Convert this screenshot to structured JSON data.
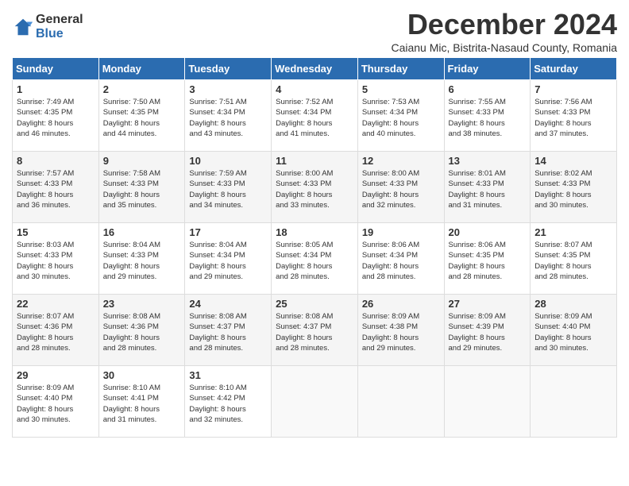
{
  "logo": {
    "general": "General",
    "blue": "Blue"
  },
  "title": "December 2024",
  "location": "Caianu Mic, Bistrita-Nasaud County, Romania",
  "days_of_week": [
    "Sunday",
    "Monday",
    "Tuesday",
    "Wednesday",
    "Thursday",
    "Friday",
    "Saturday"
  ],
  "weeks": [
    [
      {
        "day": "1",
        "sunrise": "7:49 AM",
        "sunset": "4:35 PM",
        "daylight": "8 hours and 46 minutes."
      },
      {
        "day": "2",
        "sunrise": "7:50 AM",
        "sunset": "4:35 PM",
        "daylight": "8 hours and 44 minutes."
      },
      {
        "day": "3",
        "sunrise": "7:51 AM",
        "sunset": "4:34 PM",
        "daylight": "8 hours and 43 minutes."
      },
      {
        "day": "4",
        "sunrise": "7:52 AM",
        "sunset": "4:34 PM",
        "daylight": "8 hours and 41 minutes."
      },
      {
        "day": "5",
        "sunrise": "7:53 AM",
        "sunset": "4:34 PM",
        "daylight": "8 hours and 40 minutes."
      },
      {
        "day": "6",
        "sunrise": "7:55 AM",
        "sunset": "4:33 PM",
        "daylight": "8 hours and 38 minutes."
      },
      {
        "day": "7",
        "sunrise": "7:56 AM",
        "sunset": "4:33 PM",
        "daylight": "8 hours and 37 minutes."
      }
    ],
    [
      {
        "day": "8",
        "sunrise": "7:57 AM",
        "sunset": "4:33 PM",
        "daylight": "8 hours and 36 minutes."
      },
      {
        "day": "9",
        "sunrise": "7:58 AM",
        "sunset": "4:33 PM",
        "daylight": "8 hours and 35 minutes."
      },
      {
        "day": "10",
        "sunrise": "7:59 AM",
        "sunset": "4:33 PM",
        "daylight": "8 hours and 34 minutes."
      },
      {
        "day": "11",
        "sunrise": "8:00 AM",
        "sunset": "4:33 PM",
        "daylight": "8 hours and 33 minutes."
      },
      {
        "day": "12",
        "sunrise": "8:00 AM",
        "sunset": "4:33 PM",
        "daylight": "8 hours and 32 minutes."
      },
      {
        "day": "13",
        "sunrise": "8:01 AM",
        "sunset": "4:33 PM",
        "daylight": "8 hours and 31 minutes."
      },
      {
        "day": "14",
        "sunrise": "8:02 AM",
        "sunset": "4:33 PM",
        "daylight": "8 hours and 30 minutes."
      }
    ],
    [
      {
        "day": "15",
        "sunrise": "8:03 AM",
        "sunset": "4:33 PM",
        "daylight": "8 hours and 30 minutes."
      },
      {
        "day": "16",
        "sunrise": "8:04 AM",
        "sunset": "4:33 PM",
        "daylight": "8 hours and 29 minutes."
      },
      {
        "day": "17",
        "sunrise": "8:04 AM",
        "sunset": "4:34 PM",
        "daylight": "8 hours and 29 minutes."
      },
      {
        "day": "18",
        "sunrise": "8:05 AM",
        "sunset": "4:34 PM",
        "daylight": "8 hours and 28 minutes."
      },
      {
        "day": "19",
        "sunrise": "8:06 AM",
        "sunset": "4:34 PM",
        "daylight": "8 hours and 28 minutes."
      },
      {
        "day": "20",
        "sunrise": "8:06 AM",
        "sunset": "4:35 PM",
        "daylight": "8 hours and 28 minutes."
      },
      {
        "day": "21",
        "sunrise": "8:07 AM",
        "sunset": "4:35 PM",
        "daylight": "8 hours and 28 minutes."
      }
    ],
    [
      {
        "day": "22",
        "sunrise": "8:07 AM",
        "sunset": "4:36 PM",
        "daylight": "8 hours and 28 minutes."
      },
      {
        "day": "23",
        "sunrise": "8:08 AM",
        "sunset": "4:36 PM",
        "daylight": "8 hours and 28 minutes."
      },
      {
        "day": "24",
        "sunrise": "8:08 AM",
        "sunset": "4:37 PM",
        "daylight": "8 hours and 28 minutes."
      },
      {
        "day": "25",
        "sunrise": "8:08 AM",
        "sunset": "4:37 PM",
        "daylight": "8 hours and 28 minutes."
      },
      {
        "day": "26",
        "sunrise": "8:09 AM",
        "sunset": "4:38 PM",
        "daylight": "8 hours and 29 minutes."
      },
      {
        "day": "27",
        "sunrise": "8:09 AM",
        "sunset": "4:39 PM",
        "daylight": "8 hours and 29 minutes."
      },
      {
        "day": "28",
        "sunrise": "8:09 AM",
        "sunset": "4:40 PM",
        "daylight": "8 hours and 30 minutes."
      }
    ],
    [
      {
        "day": "29",
        "sunrise": "8:09 AM",
        "sunset": "4:40 PM",
        "daylight": "8 hours and 30 minutes."
      },
      {
        "day": "30",
        "sunrise": "8:10 AM",
        "sunset": "4:41 PM",
        "daylight": "8 hours and 31 minutes."
      },
      {
        "day": "31",
        "sunrise": "8:10 AM",
        "sunset": "4:42 PM",
        "daylight": "8 hours and 32 minutes."
      },
      null,
      null,
      null,
      null
    ]
  ],
  "labels": {
    "sunrise": "Sunrise:",
    "sunset": "Sunset:",
    "daylight": "Daylight:"
  }
}
